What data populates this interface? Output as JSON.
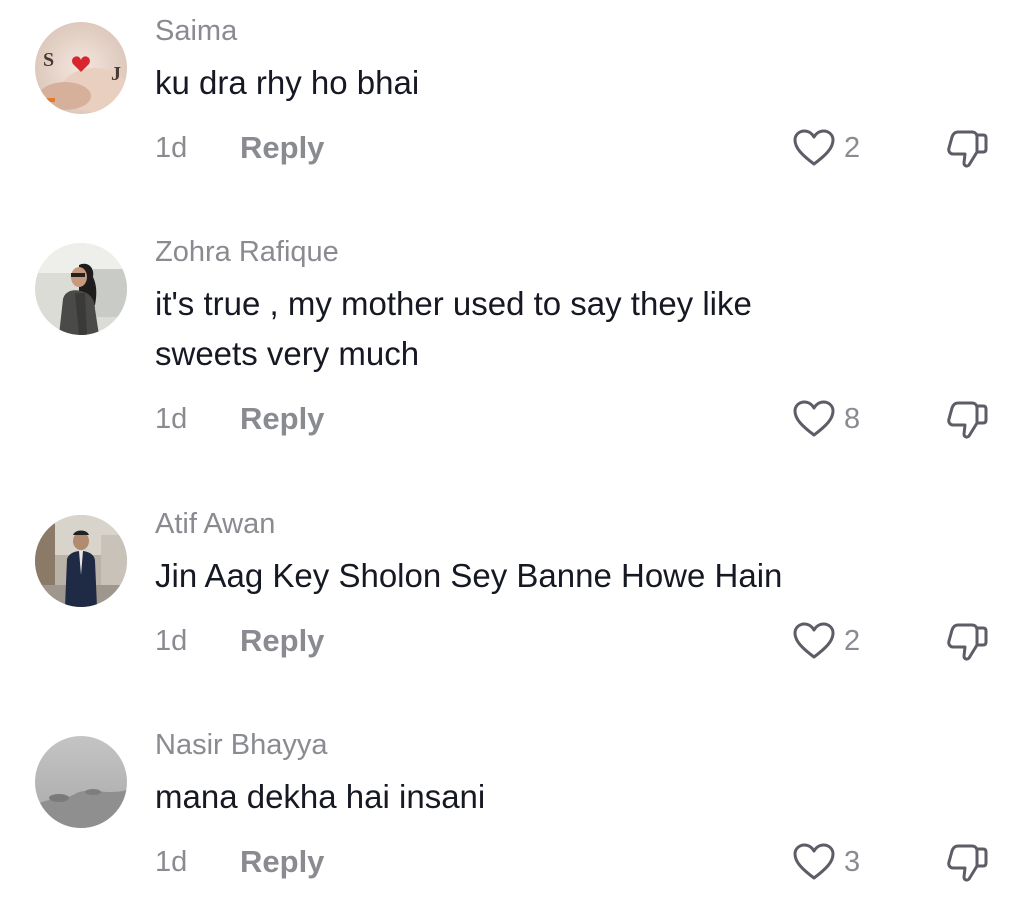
{
  "comments": [
    {
      "username": "Saima",
      "text": [
        "ku dra rhy ho bhai"
      ],
      "time": "1d",
      "reply_label": "Reply",
      "likes": "2",
      "avatar_text_left": "S",
      "avatar_text_right": "J"
    },
    {
      "username": "Zohra Rafique",
      "text": [
        "it's true , my mother used to say they like",
        "sweets very much"
      ],
      "time": "1d",
      "reply_label": "Reply",
      "likes": "8"
    },
    {
      "username": "Atif Awan",
      "text": [
        "Jin Aag Key Sholon Sey Banne Howe Hain"
      ],
      "time": "1d",
      "reply_label": "Reply",
      "likes": "2"
    },
    {
      "username": "Nasir Bhayya",
      "text": [
        "mana dekha hai insani"
      ],
      "time": "1d",
      "reply_label": "Reply",
      "likes": "3"
    }
  ],
  "colors": {
    "text_primary": "#161823",
    "text_secondary": "#8a8b91",
    "icon": "#5c5d66",
    "background": "#ffffff"
  },
  "icons": {
    "like": "heart-outline-icon",
    "dislike": "thumbs-down-outline-icon"
  }
}
